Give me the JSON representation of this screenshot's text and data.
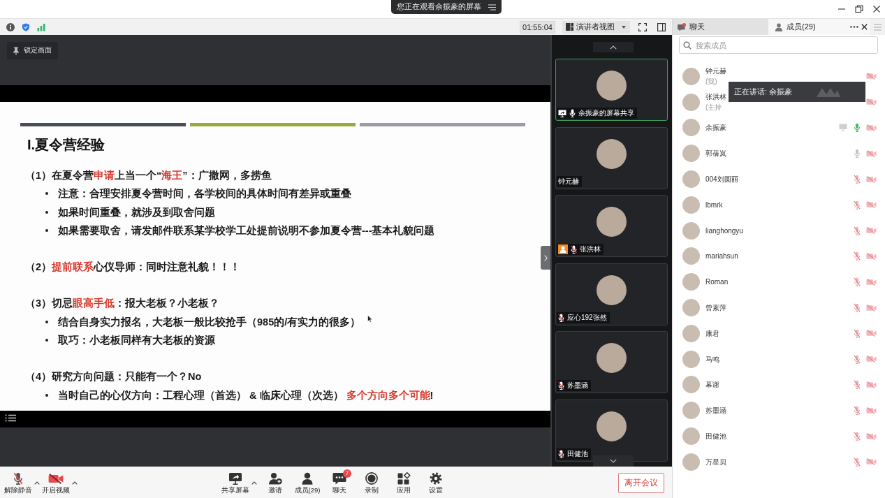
{
  "banner": {
    "text": "您正在观看余振豪的屏幕"
  },
  "toolbar": {
    "timer": "01:55:04",
    "view_mode": "演讲者视图"
  },
  "side_tabs": [
    {
      "label": "聊天",
      "kind": "chat",
      "selected": false,
      "unread": true
    },
    {
      "label": "成员(29)",
      "kind": "members",
      "selected": true,
      "unread": false
    }
  ],
  "stage": {
    "lock_button": "锁定画面"
  },
  "slide": {
    "title": "I.夏令营经验",
    "blocks": [
      {
        "heading": [
          {
            "text": "（1）在夏令营",
            "highlight": false
          },
          {
            "text": "申请",
            "highlight": true
          },
          {
            "text": "上当一个“",
            "highlight": false
          },
          {
            "text": "海王",
            "highlight": true
          },
          {
            "text": "”：广撒网，多捞鱼",
            "highlight": false
          }
        ],
        "bullets": [
          [
            {
              "text": "注意：合理安排夏令营时间，各学校间的具体时间有差异或重叠",
              "highlight": false
            }
          ],
          [
            {
              "text": "如果时间重叠，就涉及到取舍问题",
              "highlight": false
            }
          ],
          [
            {
              "text": "如果需要取舍，请发邮件联系某学校学工处提前说明不参加夏令营---基本礼貌问题",
              "highlight": false
            }
          ]
        ]
      },
      {
        "heading": [
          {
            "text": "（2）",
            "highlight": false
          },
          {
            "text": "提前联系",
            "highlight": true
          },
          {
            "text": "心仪导师：同时注意礼貌！！！",
            "highlight": false
          }
        ]
      },
      {
        "heading": [
          {
            "text": "（3）切忌",
            "highlight": false
          },
          {
            "text": "眼高手低",
            "highlight": true
          },
          {
            "text": "：报大老板？小老板？",
            "highlight": false
          }
        ],
        "bullets": [
          [
            {
              "text": "结合自身实力报名，大老板一般比较抢手（985的/有实力的很多）",
              "highlight": false
            }
          ],
          [
            {
              "text": "取巧：小老板同样有大老板的资源",
              "highlight": false
            }
          ]
        ]
      },
      {
        "heading": [
          {
            "text": "（4）研究方向问题：只能有一个？No",
            "highlight": false
          }
        ],
        "bullets": [
          [
            {
              "text": "当时自己的心仪方向：工程心理（首选） & 临床心理（次选） ",
              "highlight": false
            },
            {
              "text": "多个方向多个可能",
              "highlight": true
            },
            {
              "text": "!",
              "highlight": false
            }
          ]
        ]
      }
    ]
  },
  "video_tiles": [
    {
      "name": "余振豪的屏幕共享",
      "active": true,
      "sharing": true,
      "host": false,
      "mic": true,
      "muted": false
    },
    {
      "name": "钟元赫",
      "active": false,
      "sharing": false,
      "host": false,
      "mic": false
    },
    {
      "name": "张洪林",
      "active": false,
      "sharing": false,
      "host": true,
      "mic": true,
      "muted": true
    },
    {
      "name": "应心192张然",
      "active": false,
      "sharing": false,
      "host": false,
      "mic": true,
      "muted": true
    },
    {
      "name": "苏墨涵",
      "active": false,
      "sharing": false,
      "host": false,
      "mic": true,
      "muted": true
    },
    {
      "name": "田健池",
      "active": false,
      "sharing": false,
      "host": false,
      "mic": true,
      "muted": true
    }
  ],
  "search": {
    "placeholder": "搜索成员"
  },
  "members": [
    {
      "name": "钟元赫",
      "note": "(我)",
      "sharing": false,
      "mic": false,
      "camera_off": true
    },
    {
      "name": "张洪林",
      "note": "(主持",
      "sharing": false,
      "mic": false,
      "camera_off": true
    },
    {
      "name": "余振豪",
      "sharing": true,
      "mic": true,
      "muted": false,
      "speaking": true,
      "camera_off": true
    },
    {
      "name": "郭蒨岚",
      "sharing": false,
      "mic": true,
      "muted": false,
      "speaking": false,
      "camera_off": true
    },
    {
      "name": "004刘圆丽",
      "sharing": false,
      "mic": true,
      "muted": true,
      "camera_off": true
    },
    {
      "name": "lbmrk",
      "sharing": false,
      "mic": true,
      "muted": true,
      "camera_off": true
    },
    {
      "name": "lianghongyu",
      "sharing": false,
      "mic": true,
      "muted": true,
      "camera_off": true
    },
    {
      "name": "mariahsun",
      "sharing": false,
      "mic": true,
      "muted": true,
      "camera_off": true
    },
    {
      "name": "Roman",
      "sharing": false,
      "mic": true,
      "muted": true,
      "camera_off": true
    },
    {
      "name": "曾素萍",
      "sharing": false,
      "mic": true,
      "muted": true,
      "camera_off": true
    },
    {
      "name": "康君",
      "sharing": false,
      "mic": true,
      "muted": true,
      "camera_off": true
    },
    {
      "name": "马鸣",
      "sharing": false,
      "mic": true,
      "muted": true,
      "camera_off": true
    },
    {
      "name": "幕谢",
      "sharing": false,
      "mic": true,
      "muted": true,
      "camera_off": true
    },
    {
      "name": "苏墨涵",
      "sharing": false,
      "mic": true,
      "muted": true,
      "camera_off": true
    },
    {
      "name": "田健池",
      "sharing": false,
      "mic": true,
      "muted": true,
      "camera_off": true
    },
    {
      "name": "万星贝",
      "sharing": false,
      "mic": true,
      "muted": true,
      "camera_off": true
    }
  ],
  "speaking_tooltip": {
    "text": "正在讲话: 余振豪"
  },
  "bottom_bar": {
    "left": [
      {
        "label": "解除静音",
        "kind": "mic-muted",
        "menu": true
      },
      {
        "label": "开启视频",
        "kind": "video-off",
        "menu": true
      }
    ],
    "center": [
      {
        "label": "共享屏幕",
        "kind": "share",
        "menu": true
      },
      {
        "label": "邀请",
        "kind": "invite",
        "menu": false
      },
      {
        "label": "成员(29)",
        "kind": "members",
        "menu": false
      },
      {
        "label": "聊天",
        "kind": "chat",
        "menu": false,
        "badge": "7"
      },
      {
        "label": "录制",
        "kind": "record",
        "menu": false
      },
      {
        "label": "应用",
        "kind": "apps",
        "menu": false
      },
      {
        "label": "设置",
        "kind": "settings",
        "menu": false
      }
    ],
    "leave": "离开会议"
  }
}
